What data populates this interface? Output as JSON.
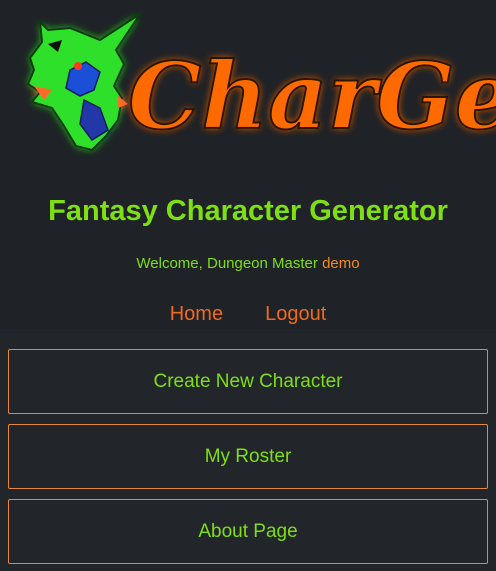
{
  "logo": {
    "text": "CharGen",
    "icon": "dragon-head-icon"
  },
  "header": {
    "title": "Fantasy Character Generator",
    "welcome_prefix": "Welcome, Dungeon Master",
    "username": "demo"
  },
  "nav": {
    "home_label": "Home",
    "logout_label": "Logout"
  },
  "menu": {
    "create_label": "Create New Character",
    "roster_label": "My Roster",
    "about_label": "About Page"
  },
  "colors": {
    "accent_green": "#7ddf14",
    "accent_orange": "#ee6a1e",
    "background": "#202428"
  }
}
